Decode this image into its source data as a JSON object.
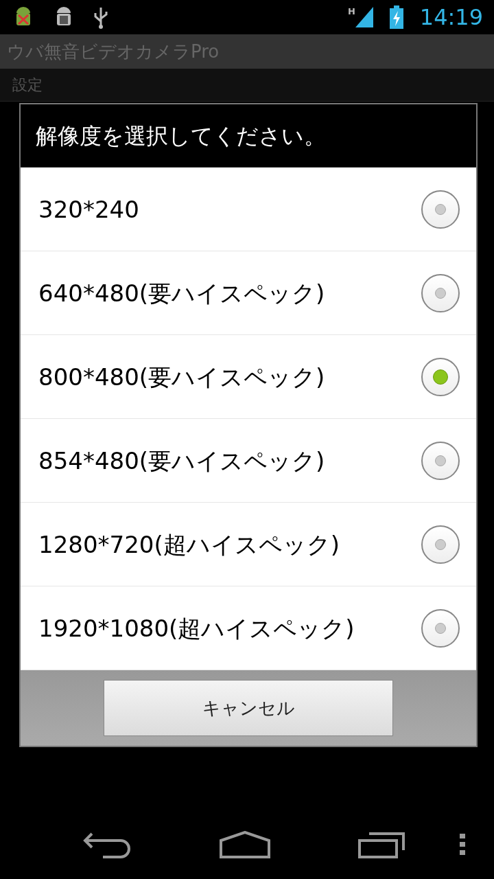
{
  "status_bar": {
    "network": "H",
    "time": "14:19"
  },
  "action_bar": {
    "title": "ウバ無音ビデオカメラPro"
  },
  "category": {
    "title": "設定"
  },
  "dialog": {
    "title": "解像度を選択してください。",
    "options": [
      {
        "label": "320*240",
        "selected": false
      },
      {
        "label": "640*480(要ハイスペック)",
        "selected": false
      },
      {
        "label": "800*480(要ハイスペック)",
        "selected": true
      },
      {
        "label": "854*480(要ハイスペック)",
        "selected": false
      },
      {
        "label": "1280*720(超ハイスペック)",
        "selected": false
      },
      {
        "label": "1920*1080(超ハイスペック)",
        "selected": false
      }
    ],
    "cancel_button": "キャンセル"
  }
}
